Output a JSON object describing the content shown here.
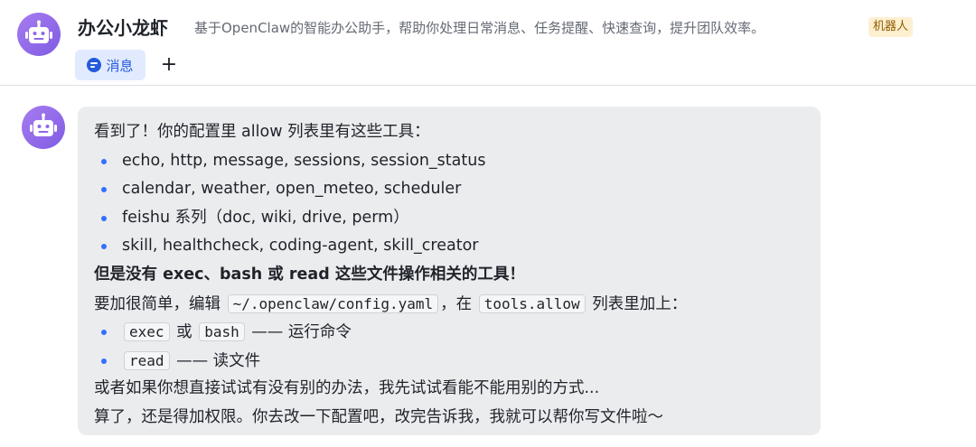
{
  "header": {
    "title": "办公小龙虾",
    "description": "基于OpenClaw的智能办公助手，帮助你处理日常消息、任务提醒、快速查询，提升团队效率。",
    "tag": "机器人",
    "tabs": [
      {
        "label": "消息",
        "icon": "chat-bubble-icon"
      }
    ],
    "add_tab": "+"
  },
  "message": {
    "intro": "看到了！你的配置里 allow 列表里有这些工具：",
    "tools": [
      "echo, http, message, sessions, session_status",
      "calendar, weather, open_meteo, scheduler",
      "feishu 系列（doc, wiki, drive, perm）",
      "skill, healthcheck, coding-agent, skill_creator"
    ],
    "missing": "但是没有 exec、bash 或 read 这些文件操作相关的工具！",
    "fix": {
      "prefix": "要加很简单，编辑",
      "config_path": "~/.openclaw/config.yaml",
      "mid": "，在",
      "key": "tools.allow",
      "suffix": "列表里加上："
    },
    "add_items": [
      {
        "code1": "exec",
        "joiner": "或",
        "code2": "bash",
        "desc": "—— 运行命令"
      },
      {
        "code1": "read",
        "desc": "—— 读文件"
      }
    ],
    "alt": "或者如果你想直接试试有没有别的办法，我先试试看能不能用别的方式...",
    "closing": "算了，还是得加权限。你去改一下配置吧，改完告诉我，我就可以帮你写文件啦～"
  },
  "colors": {
    "accent": "#3370ff",
    "bubble": "#ebecee",
    "avatar": "#8e68ea",
    "tag_bg": "#fdf0d1"
  }
}
